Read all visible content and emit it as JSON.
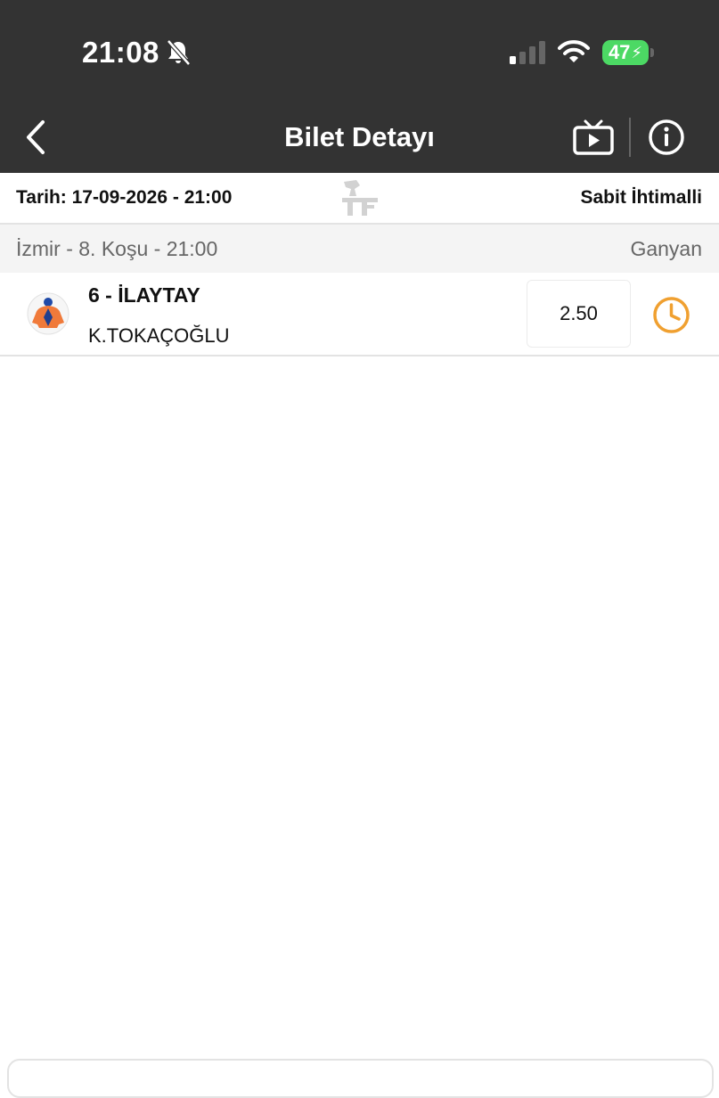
{
  "status_bar": {
    "time": "21:08",
    "battery": "47",
    "icons": [
      "bell-slash-icon",
      "signal-icon",
      "wifi-icon",
      "battery-charging-icon"
    ]
  },
  "header": {
    "title": "Bilet Detayı",
    "icons": [
      "back-chevron-icon",
      "tv-play-icon",
      "info-icon"
    ]
  },
  "ticket": {
    "date_label": "Tarih: 17-09-2026 - 21:00",
    "type_label": "Sabit İhtimalli"
  },
  "race": {
    "info": "İzmir - 8. Koşu - 21:00",
    "bet_type": "Ganyan"
  },
  "selection": {
    "horse": "6 - İLAYTAY",
    "jockey": "K.TOKAÇOĞLU",
    "odds": "2.50",
    "status_icon": "clock-icon"
  },
  "colors": {
    "header_bg": "#333333",
    "accent_orange": "#f0a030",
    "battery_green": "#4cd964",
    "row_bar_bg": "#f4f4f4"
  }
}
